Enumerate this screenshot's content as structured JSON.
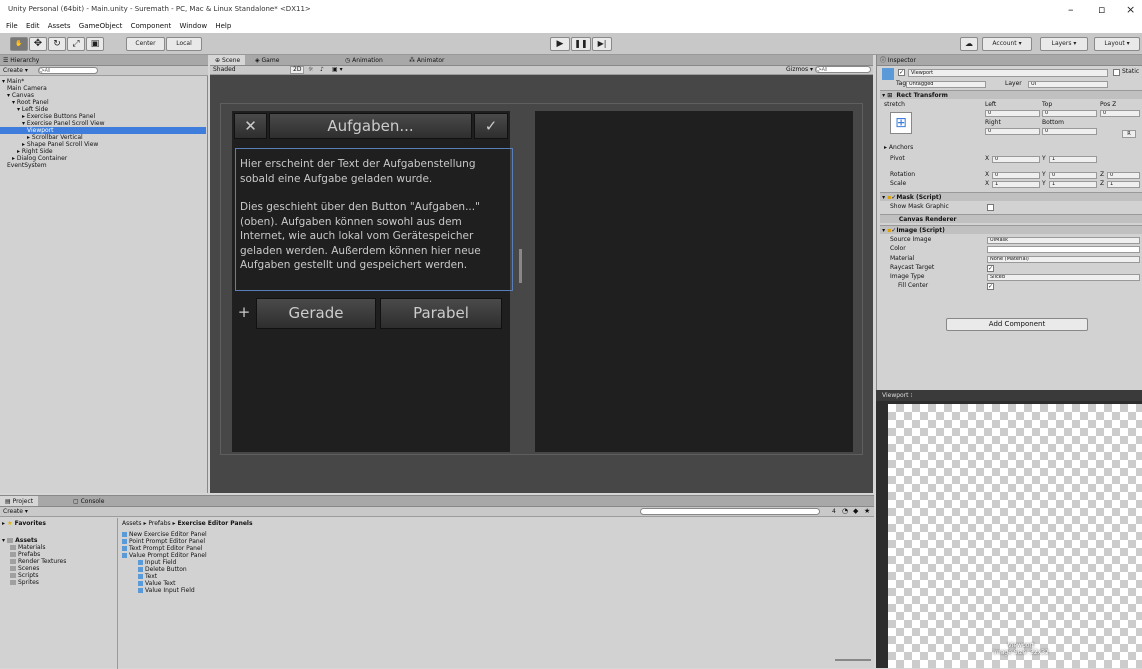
{
  "window": {
    "title": "Unity Personal (64bit) - Main.unity - Suremath - PC, Mac & Linux Standalone* <DX11>",
    "minimize": "–",
    "maximize": "▫",
    "close": "×"
  },
  "menu": [
    "File",
    "Edit",
    "Assets",
    "GameObject",
    "Component",
    "Window",
    "Help"
  ],
  "toolbar": {
    "center_label": "Center",
    "local_label": "Local",
    "account_label": "Account",
    "layers_label": "Layers",
    "layout_label": "Layout"
  },
  "hierarchy": {
    "tab": "Hierarchy",
    "create": "Create",
    "search_placeholder": "Q•All",
    "items": [
      {
        "label": "▾ Main*",
        "indent": 0
      },
      {
        "label": "Main Camera",
        "indent": 1
      },
      {
        "label": "▾ Canvas",
        "indent": 1
      },
      {
        "label": "▾ Root Panel",
        "indent": 2
      },
      {
        "label": "▾ Left Side",
        "indent": 3
      },
      {
        "label": "▸ Exercise Buttons Panel",
        "indent": 4
      },
      {
        "label": "▾ Exercise Panel Scroll View",
        "indent": 4
      },
      {
        "label": "Viewport",
        "indent": 5,
        "selected": true
      },
      {
        "label": "▸ Scrollbar Vertical",
        "indent": 5
      },
      {
        "label": "▸ Shape Panel Scroll View",
        "indent": 4
      },
      {
        "label": "▸ Right Side",
        "indent": 3
      },
      {
        "label": "▸ Dialog Container",
        "indent": 2
      },
      {
        "label": "EventSystem",
        "indent": 1
      }
    ]
  },
  "scene": {
    "tabs": [
      "Scene",
      "Game",
      "Animation",
      "Animator"
    ],
    "shaded": "Shaded",
    "mode_2d": "2D",
    "gizmos": "Gizmos",
    "search_placeholder": "Q•All"
  },
  "app_ui": {
    "close_btn": "✕",
    "aufgaben_btn": "Aufgaben...",
    "check_btn": "✓",
    "text_para1": "Hier erscheint der Text der Aufgabenstellung sobald eine Aufgabe geladen wurde.",
    "text_para2": "Dies geschieht über den Button \"Aufgaben...\" (oben). Aufgaben können sowohl aus dem Internet, wie auch lokal vom Gerätespeicher geladen werden. Außerdem können hier neue Aufgaben gestellt und gespeichert werden.",
    "plus_btn": "+",
    "gerade_btn": "Gerade",
    "parabel_btn": "Parabel"
  },
  "inspector": {
    "tab": "Inspector",
    "object_name": "Viewport",
    "static_label": "Static",
    "tag_label": "Tag",
    "tag_value": "Untagged",
    "layer_label": "Layer",
    "layer_value": "UI",
    "rect_transform": {
      "title": "Rect Transform",
      "stretch_label": "stretch",
      "left_label": "Left",
      "top_label": "Top",
      "posz_label": "Pos Z",
      "left": "0",
      "top": "0",
      "posz": "0",
      "right_label": "Right",
      "bottom_label": "Bottom",
      "right": "0",
      "bottom": "0",
      "anchors_label": "Anchors",
      "pivot_label": "Pivot",
      "pivot_x": "0",
      "pivot_y": "1",
      "rotation_label": "Rotation",
      "rot_x": "0",
      "rot_y": "0",
      "rot_z": "0",
      "scale_label": "Scale",
      "scale_x": "1",
      "scale_y": "1",
      "scale_z": "1"
    },
    "mask": {
      "title": "Mask (Script)",
      "show_mask_graphic": "Show Mask Graphic"
    },
    "canvas_renderer": {
      "title": "Canvas Renderer"
    },
    "image": {
      "title": "Image (Script)",
      "source_image_label": "Source Image",
      "source_image": "UIMask",
      "color_label": "Color",
      "material_label": "Material",
      "material": "None (Material)",
      "raycast_label": "Raycast Target",
      "image_type_label": "Image Type",
      "image_type": "Sliced",
      "fill_center_label": "Fill Center"
    },
    "add_component": "Add Component"
  },
  "preview": {
    "title": "Viewport",
    "caption_line1": "Viewport",
    "caption_line2": "Image Size: 32x32"
  },
  "project": {
    "tabs": [
      "Project",
      "Console"
    ],
    "create": "Create",
    "count_badge": "4",
    "favorites": "Favorites",
    "assets": "Assets",
    "folders": [
      "Materials",
      "Prefabs",
      "Render Textures",
      "Scenes",
      "Scripts",
      "Sprites"
    ],
    "breadcrumb": [
      "Assets",
      "Prefabs",
      "Exercise Editor Panels"
    ],
    "files": [
      {
        "label": "New Exercise Editor Panel",
        "indent": 0
      },
      {
        "label": "Point Prompt Editor Panel",
        "indent": 0
      },
      {
        "label": "Text Prompt Editor Panel",
        "indent": 0
      },
      {
        "label": "Value Prompt Editor Panel",
        "indent": 0
      },
      {
        "label": "Input Field",
        "indent": 1
      },
      {
        "label": "Delete Button",
        "indent": 1
      },
      {
        "label": "Text",
        "indent": 1
      },
      {
        "label": "Value Text",
        "indent": 1
      },
      {
        "label": "Value Input Field",
        "indent": 1
      }
    ]
  }
}
